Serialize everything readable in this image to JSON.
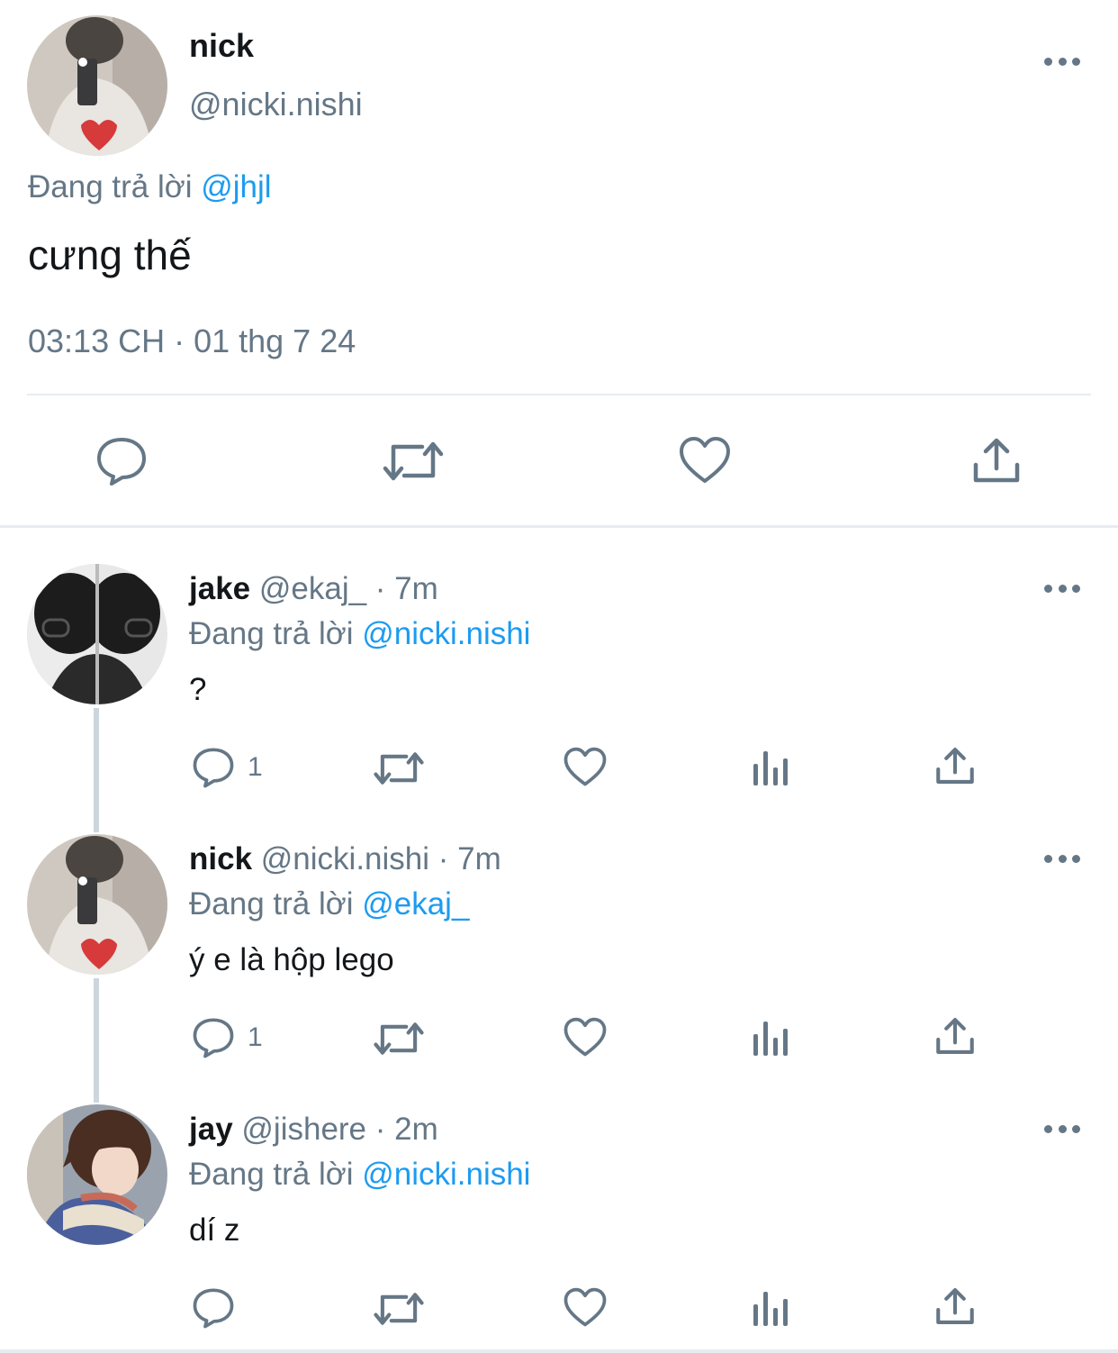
{
  "main_tweet": {
    "display_name": "nick",
    "handle": "@nicki.nishi",
    "replying_prefix": "Đang trả lời",
    "replying_to": "@jhjl",
    "text": "cưng thế",
    "timestamp": "03:13 CH · 01 thg 7 24",
    "actions": [
      "reply-icon",
      "retweet-icon",
      "like-icon",
      "share-icon"
    ]
  },
  "replies": [
    {
      "display_name": "jake",
      "meta": "@ekaj_ · 7m",
      "replying_prefix": "Đang trả lời",
      "replying_to": "@nicki.nishi",
      "text": "?",
      "reply_count": "1"
    },
    {
      "display_name": "nick",
      "meta": "@nicki.nishi · 7m",
      "replying_prefix": "Đang trả lời",
      "replying_to": "@ekaj_",
      "text": "ý e là hộp lego",
      "reply_count": "1"
    },
    {
      "display_name": "jay",
      "meta": "@jishere · 2m",
      "replying_prefix": "Đang trả lời",
      "replying_to": "@nicki.nishi",
      "text": "dí z",
      "reply_count": ""
    }
  ],
  "colors": {
    "text": "#14171a",
    "secondary": "#657786",
    "mention": "#1d9bf0",
    "divider": "#e6ecf0"
  }
}
